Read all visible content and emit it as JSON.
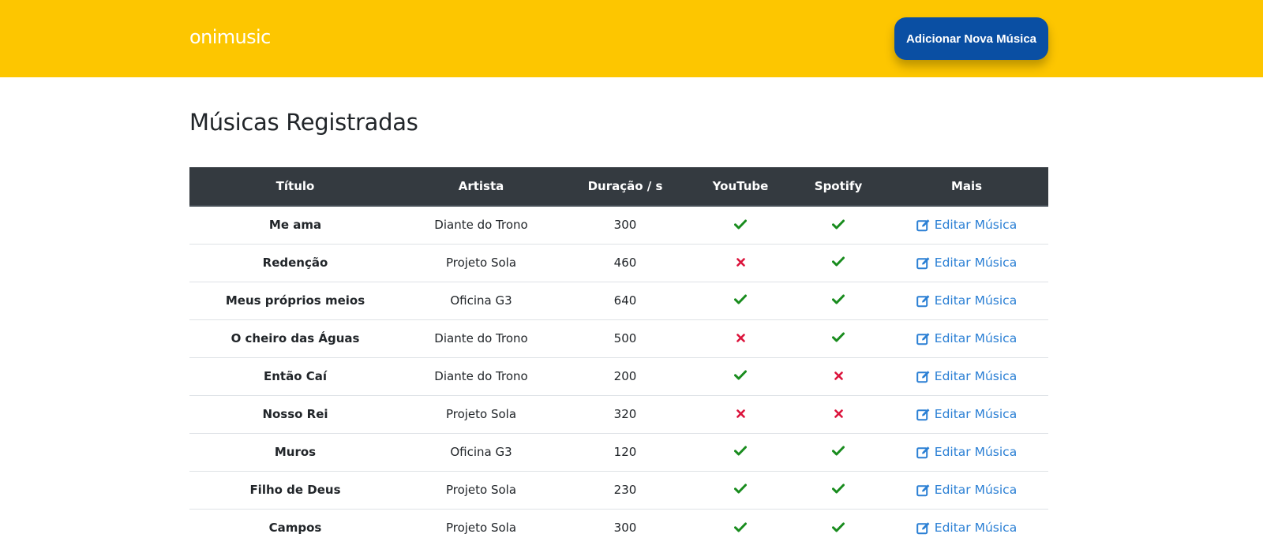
{
  "header": {
    "logo_text": "onimusic",
    "add_button_label": "Adicionar Nova Música",
    "background_color": "#fdc600",
    "button_color": "#0a4fa3"
  },
  "main": {
    "page_title": "Músicas Registradas"
  },
  "table": {
    "columns": [
      "Título",
      "Artista",
      "Duração / s",
      "YouTube",
      "Spotify",
      "Mais"
    ],
    "rows": [
      {
        "title": "Me ama",
        "artist": "Diante do Trono",
        "duration": "300",
        "youtube": true,
        "spotify": true,
        "action": "Editar Música"
      },
      {
        "title": "Redenção",
        "artist": "Projeto Sola",
        "duration": "460",
        "youtube": false,
        "spotify": true,
        "action": "Editar Música"
      },
      {
        "title": "Meus próprios meios",
        "artist": "Oficina G3",
        "duration": "640",
        "youtube": true,
        "spotify": true,
        "action": "Editar Música"
      },
      {
        "title": "O cheiro das Águas",
        "artist": "Diante do Trono",
        "duration": "500",
        "youtube": false,
        "spotify": true,
        "action": "Editar Música"
      },
      {
        "title": "Então Caí",
        "artist": "Diante do Trono",
        "duration": "200",
        "youtube": true,
        "spotify": false,
        "action": "Editar Música"
      },
      {
        "title": "Nosso Rei",
        "artist": "Projeto Sola",
        "duration": "320",
        "youtube": false,
        "spotify": false,
        "action": "Editar Música"
      },
      {
        "title": "Muros",
        "artist": "Oficina G3",
        "duration": "120",
        "youtube": true,
        "spotify": true,
        "action": "Editar Música"
      },
      {
        "title": "Filho de Deus",
        "artist": "Projeto Sola",
        "duration": "230",
        "youtube": true,
        "spotify": true,
        "action": "Editar Música"
      },
      {
        "title": "Campos",
        "artist": "Projeto Sola",
        "duration": "300",
        "youtube": true,
        "spotify": true,
        "action": "Editar Música"
      }
    ],
    "icons": {
      "available": "check-icon",
      "unavailable": "cross-icon",
      "edit": "edit-icon"
    },
    "colors": {
      "check": "#198c1e",
      "cross": "#dc143c",
      "link": "#2a7fd4",
      "header_bg": "#343a40"
    }
  }
}
